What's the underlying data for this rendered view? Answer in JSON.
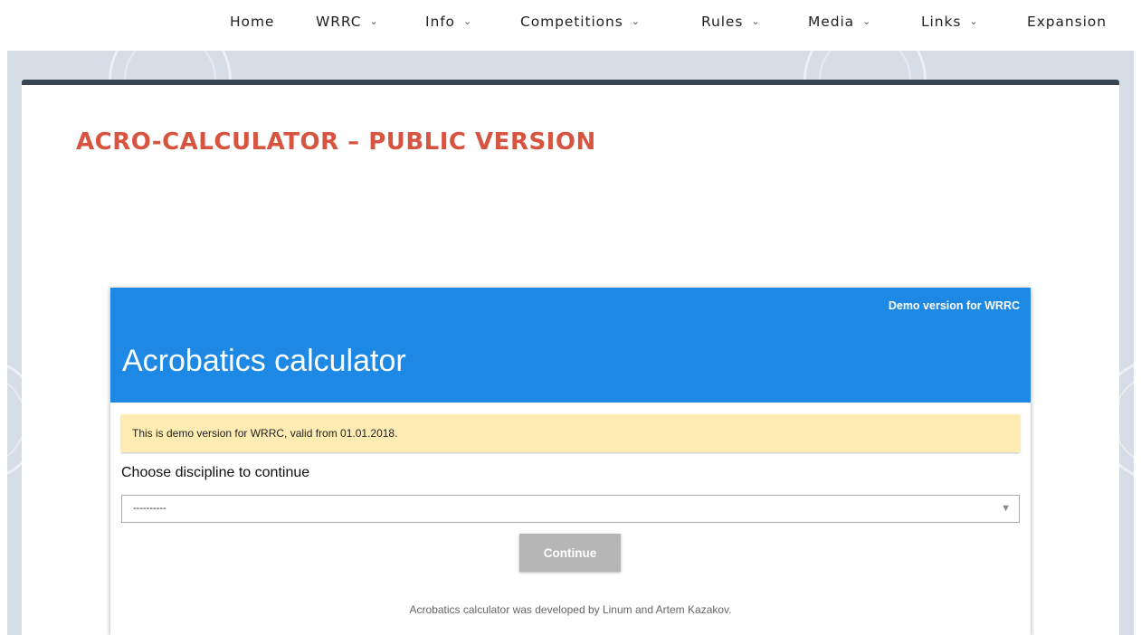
{
  "nav": {
    "items": [
      {
        "label": "Home",
        "dropdown": false
      },
      {
        "label": "WRRC",
        "dropdown": true
      },
      {
        "label": "Info",
        "dropdown": true
      },
      {
        "label": "Competitions",
        "dropdown": true
      },
      {
        "label": "Rules",
        "dropdown": true
      },
      {
        "label": "Media",
        "dropdown": true
      },
      {
        "label": "Links",
        "dropdown": true
      },
      {
        "label": "Expansion",
        "dropdown": false
      }
    ]
  },
  "page": {
    "title": "ACRO-CALCULATOR – PUBLIC VERSION"
  },
  "calculator": {
    "demo_tag": "Demo version for WRRC",
    "title": "Acrobatics calculator",
    "notice": "This is demo version for WRRC, valid from 01.01.2018.",
    "choose_label": "Choose discipline to continue",
    "select_value": "----------",
    "continue_label": "Continue",
    "credits": "Acrobatics calculator was developed by Linum and Artem Kazakov."
  },
  "colors": {
    "title_red": "#d65440",
    "header_blue": "#1e88e5",
    "notice_yellow": "#ffecb3",
    "band_gray": "#d5dde6",
    "card_border": "#3a4553",
    "button_disabled": "#b6b6b6"
  },
  "icons": {
    "dropdown_chevron": "chevron-down-icon",
    "select_arrow": "triangle-down-icon"
  }
}
